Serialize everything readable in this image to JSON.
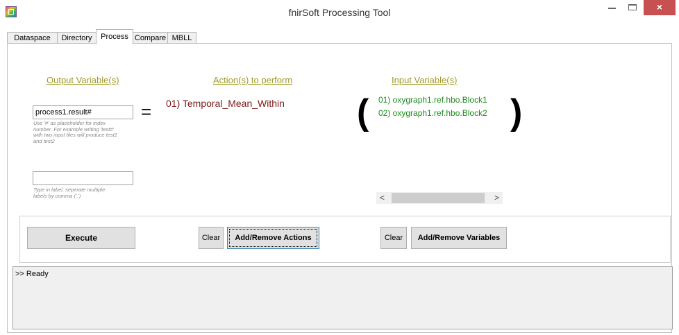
{
  "window": {
    "title": "fnirSoft Processing Tool",
    "icon": "app-icon",
    "controls": {
      "minimize": "minimize-icon",
      "maximize": "maximize-icon",
      "close": "×"
    }
  },
  "tabs": [
    {
      "label": "Dataspace",
      "active": false
    },
    {
      "label": "Directory",
      "active": false
    },
    {
      "label": "Process",
      "active": true
    },
    {
      "label": "Compare",
      "active": false
    },
    {
      "label": "MBLL",
      "active": false
    }
  ],
  "output": {
    "header": "Output Variable(s)",
    "value": "process1.result#",
    "hint": "Use '#' as placeholder for index number. For example writing 'test#' with two input files will produce test1 and test2",
    "hint_lines": [
      "Use '#' as placeholder for index",
      "number. For example writing 'test#'",
      "with two input files will produce test1",
      "and test2"
    ],
    "label_value": "",
    "label_hint_lines": [
      "Type in label, seperate multiple",
      "labels by comma (',')"
    ]
  },
  "equals": "=",
  "actions": {
    "header": "Action(s) to perform",
    "items": [
      "01) Temporal_Mean_Within"
    ]
  },
  "inputs": {
    "header": "Input Variable(s)",
    "open_paren": "(",
    "close_paren": ")",
    "items": [
      "01) oxygraph1.ref.hbo.Block1",
      "02) oxygraph1.ref.hbo.Block2"
    ],
    "scroll_left": "<",
    "scroll_right": ">"
  },
  "buttons": {
    "execute": "Execute",
    "clear_actions": "Clear",
    "add_remove_actions": "Add/Remove Actions",
    "clear_variables": "Clear",
    "add_remove_variables": "Add/Remove Variables"
  },
  "log": {
    "text": ">> Ready"
  },
  "colors": {
    "header": "#a09a28",
    "action_text": "#7a1a1a",
    "input_text": "#1e8a1e",
    "close_button": "#c75050"
  }
}
